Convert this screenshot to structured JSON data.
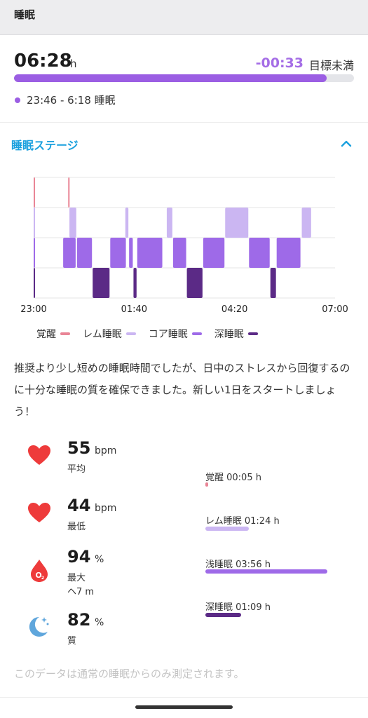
{
  "header": {
    "title": "睡眠"
  },
  "summary_card": {
    "duration": "06:28",
    "duration_unit": "h",
    "goal_diff": "-00:33",
    "goal_label": "目標未満",
    "goal_progress": 0.92,
    "time_range": "23:46 - 6:18 睡眠"
  },
  "stages_section": {
    "title": "睡眠ステージ",
    "collapse_icon": "chevron-up-icon"
  },
  "chart_data": {
    "type": "timeline",
    "x_tick_labels": [
      "23:00",
      "01:40",
      "04:20",
      "07:00"
    ],
    "x_range_minutes": [
      0,
      480
    ],
    "rows": [
      "覚醒",
      "レム睡眠",
      "コア睡眠",
      "深睡眠"
    ],
    "colors": {
      "覚醒": "#e98596",
      "レム睡眠": "#cbb6f2",
      "コア睡眠": "#9e6ae8",
      "深睡眠": "#5b2a86"
    },
    "segments": [
      {
        "stage": "覚醒",
        "start": 0,
        "end": 3
      },
      {
        "stage": "覚醒",
        "start": 55,
        "end": 57
      },
      {
        "stage": "レム睡眠",
        "start": 0,
        "end": 3
      },
      {
        "stage": "レム睡眠",
        "start": 57,
        "end": 69
      },
      {
        "stage": "レム睡眠",
        "start": 146,
        "end": 152
      },
      {
        "stage": "レム睡眠",
        "start": 212,
        "end": 222
      },
      {
        "stage": "レム睡眠",
        "start": 305,
        "end": 343
      },
      {
        "stage": "レム睡眠",
        "start": 427,
        "end": 443
      },
      {
        "stage": "コア睡眠",
        "start": 0,
        "end": 3
      },
      {
        "stage": "コア睡眠",
        "start": 47,
        "end": 68
      },
      {
        "stage": "コア睡眠",
        "start": 69,
        "end": 94
      },
      {
        "stage": "コア睡眠",
        "start": 122,
        "end": 148
      },
      {
        "stage": "コア睡眠",
        "start": 152,
        "end": 159
      },
      {
        "stage": "コア睡眠",
        "start": 165,
        "end": 206
      },
      {
        "stage": "コア睡眠",
        "start": 222,
        "end": 244
      },
      {
        "stage": "コア睡眠",
        "start": 270,
        "end": 305
      },
      {
        "stage": "コア睡眠",
        "start": 343,
        "end": 377
      },
      {
        "stage": "コア睡眠",
        "start": 387,
        "end": 426
      },
      {
        "stage": "深睡眠",
        "start": 0,
        "end": 3
      },
      {
        "stage": "深睡眠",
        "start": 94,
        "end": 122
      },
      {
        "stage": "深睡眠",
        "start": 159,
        "end": 165
      },
      {
        "stage": "深睡眠",
        "start": 244,
        "end": 270
      },
      {
        "stage": "深睡眠",
        "start": 377,
        "end": 387
      }
    ],
    "legend": [
      "覚醒",
      "レム睡眠",
      "コア睡眠",
      "深睡眠"
    ],
    "grid": true
  },
  "summary_text": "推奨より少し短めの睡眠時間でしたが、日中のストレスから回復するのに十分な睡眠の質を確保できました。新しい1日をスタートしましょう！",
  "metrics": [
    {
      "icon": "heart-icon",
      "value": "55",
      "unit": "bpm",
      "label": "平均",
      "sublabel": ""
    },
    {
      "icon": "heart-icon",
      "value": "44",
      "unit": "bpm",
      "label": "最低",
      "sublabel": ""
    },
    {
      "icon": "blood-oxygen-icon",
      "value": "94",
      "unit": "%",
      "label": "最大",
      "sublabel": "ヘ7 m"
    },
    {
      "icon": "moon-icon",
      "value": "82",
      "unit": "%",
      "label": "質",
      "sublabel": ""
    }
  ],
  "stage_durations": [
    {
      "label": "覚醒 00:05 h",
      "minutes": 5,
      "color": "#e98596"
    },
    {
      "label": "レム睡眠 01:24 h",
      "minutes": 84,
      "color": "#cbb6f2"
    },
    {
      "label": "浅睡眠 03:56 h",
      "minutes": 236,
      "color": "#9e6ae8"
    },
    {
      "label": "深睡眠 01:09 h",
      "minutes": 69,
      "color": "#5b2a86"
    }
  ],
  "footer_note": "このデータは通常の睡眠からのみ測定されます。"
}
